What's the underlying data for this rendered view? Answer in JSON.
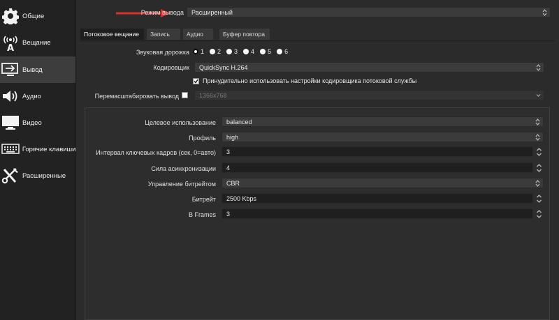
{
  "sidebar": {
    "items": [
      {
        "label": "Общие",
        "icon": "gear-icon"
      },
      {
        "label": "Вещание",
        "icon": "broadcast-icon"
      },
      {
        "label": "Вывод",
        "icon": "output-icon"
      },
      {
        "label": "Аудио",
        "icon": "speaker-icon"
      },
      {
        "label": "Видео",
        "icon": "monitor-icon"
      },
      {
        "label": "Горячие клавиши",
        "icon": "keyboard-icon"
      },
      {
        "label": "Расширенные",
        "icon": "tools-icon"
      }
    ],
    "active_index": 2
  },
  "output_mode": {
    "label": "Режим вывода",
    "value": "Расширенный"
  },
  "tabs": [
    {
      "label": "Потоковое вещание"
    },
    {
      "label": "Запись"
    },
    {
      "label": "Аудио"
    },
    {
      "label": "Буфер повтора"
    }
  ],
  "audio_track": {
    "label": "Звуковая дорожка",
    "options": [
      "1",
      "2",
      "3",
      "4",
      "5",
      "6"
    ],
    "selected": "1"
  },
  "encoder": {
    "label": "Кодировщик",
    "value": "QuickSync H.264"
  },
  "enforce": {
    "label": "Принудительно использовать настройки кодировщика потоковой службы",
    "checked": true
  },
  "rescale": {
    "label": "Перемасштабировать вывод",
    "value": "1366x768",
    "checked": false
  },
  "settings": {
    "target_usage": {
      "label": "Целевое использование",
      "value": "balanced"
    },
    "profile": {
      "label": "Профиль",
      "value": "high"
    },
    "keyframe": {
      "label": "Интервал ключевых кадров (сек, 0=авто)",
      "value": "3"
    },
    "async_depth": {
      "label": "Сила асинхронизации",
      "value": "4"
    },
    "rate_control": {
      "label": "Управление битрейтом",
      "value": "CBR"
    },
    "bitrate": {
      "label": "Битрейт",
      "value": "2500 Kbps"
    },
    "bframes": {
      "label": "B Frames",
      "value": "3"
    }
  },
  "colors": {
    "accent_arrow": "#d9302b",
    "background": "#2b2b2b",
    "sidebar": "#222222"
  }
}
